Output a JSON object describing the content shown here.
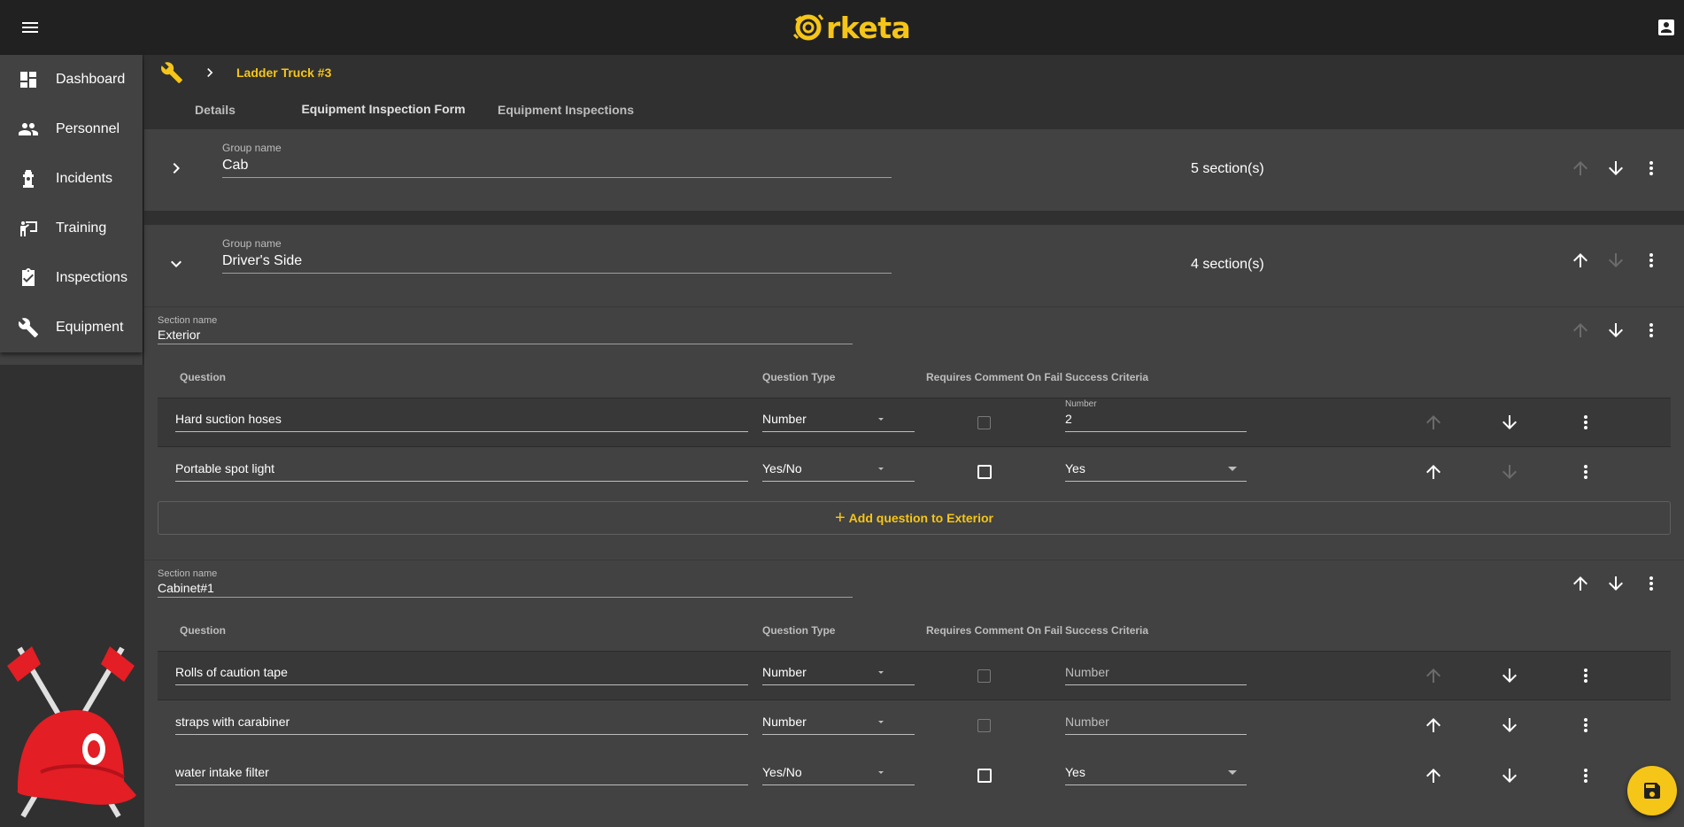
{
  "app": {
    "name": "Orketa",
    "logo_rest": "rketa"
  },
  "sidebar": {
    "items": [
      {
        "label": "Dashboard",
        "icon": "dashboard-icon"
      },
      {
        "label": "Personnel",
        "icon": "people-icon"
      },
      {
        "label": "Incidents",
        "icon": "fire-hydrant-icon"
      },
      {
        "label": "Training",
        "icon": "training-icon"
      },
      {
        "label": "Inspections",
        "icon": "inspection-icon"
      },
      {
        "label": "Equipment",
        "icon": "wrench-icon"
      }
    ]
  },
  "breadcrumb": {
    "current": "Ladder Truck #3"
  },
  "tabs": [
    {
      "label": "Details"
    },
    {
      "label": "Equipment Inspection Form"
    },
    {
      "label": "Equipment Inspections"
    }
  ],
  "groups": [
    {
      "label": "Group name",
      "name": "Cab",
      "count": "5 section(s)"
    },
    {
      "label": "Group name",
      "name": "Driver's Side",
      "count": "4 section(s)"
    }
  ],
  "columns": {
    "question": "Question",
    "type": "Question Type",
    "comment": "Requires Comment On Fail",
    "criteria": "Success Criteria"
  },
  "sections": [
    {
      "label": "Section name",
      "name": "Exterior",
      "add_label": "Add question to Exterior",
      "questions": [
        {
          "text": "Hard suction hoses",
          "type": "Number",
          "criteria_label": "Number",
          "criteria": "2"
        },
        {
          "text": "Portable spot light",
          "type": "Yes/No",
          "criteria": "Yes"
        }
      ]
    },
    {
      "label": "Section name",
      "name": "Cabinet#1",
      "questions": [
        {
          "text": "Rolls of caution tape",
          "type": "Number",
          "criteria_placeholder": "Number"
        },
        {
          "text": "straps with carabiner",
          "type": "Number",
          "criteria_placeholder": "Number"
        },
        {
          "text": "water intake filter",
          "type": "Yes/No",
          "criteria": "Yes"
        }
      ]
    }
  ],
  "colors": {
    "accent": "#f5c518",
    "topbar": "#212121",
    "panel": "#424242",
    "background": "#303030"
  }
}
